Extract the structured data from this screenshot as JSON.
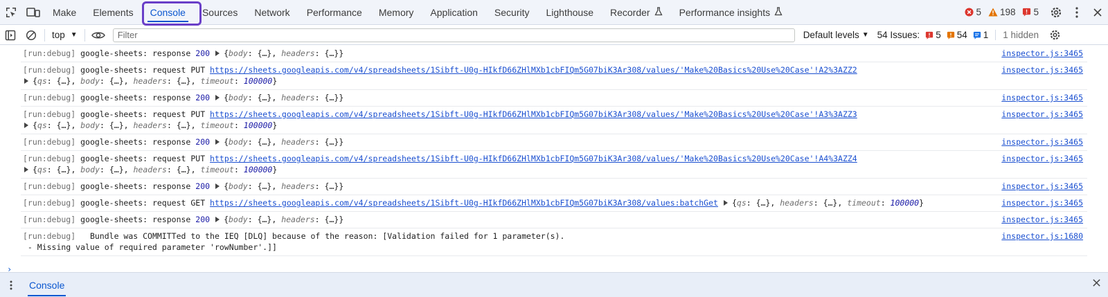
{
  "tabs": [
    {
      "label": "Make",
      "active": false,
      "flask": false
    },
    {
      "label": "Elements",
      "active": false,
      "flask": false
    },
    {
      "label": "Console",
      "active": true,
      "flask": false
    },
    {
      "label": "Sources",
      "active": false,
      "flask": false
    },
    {
      "label": "Network",
      "active": false,
      "flask": false
    },
    {
      "label": "Performance",
      "active": false,
      "flask": false
    },
    {
      "label": "Memory",
      "active": false,
      "flask": false
    },
    {
      "label": "Application",
      "active": false,
      "flask": false
    },
    {
      "label": "Security",
      "active": false,
      "flask": false
    },
    {
      "label": "Lighthouse",
      "active": false,
      "flask": false
    },
    {
      "label": "Recorder",
      "active": false,
      "flask": true
    },
    {
      "label": "Performance insights",
      "active": false,
      "flask": true
    }
  ],
  "counts": {
    "errors": "5",
    "warnings": "198",
    "issues": "5"
  },
  "toolbar": {
    "context": "top",
    "filter_placeholder": "Filter",
    "levels": "Default levels",
    "issues_label": "54 Issues:",
    "issues_errors": "5",
    "issues_warnings": "54",
    "issues_info": "1",
    "hidden": "1 hidden"
  },
  "messages": [
    {
      "prefix": "[run:debug]",
      "text": "google-sheets: response ",
      "num": "200",
      "obj": "response",
      "source": "inspector.js:3465"
    },
    {
      "prefix": "[run:debug]",
      "text": "google-sheets: request PUT ",
      "url": "https://sheets.googleapis.com/v4/spreadsheets/1Sibft-U0g-HIkfD66ZHlMXb1cbFIQm5G07biK3Ar308/values/'Make%20Basics%20Use%20Case'!A2%3AZZ2",
      "obj": "request",
      "source": "inspector.js:3465"
    },
    {
      "prefix": "[run:debug]",
      "text": "google-sheets: response ",
      "num": "200",
      "obj": "response",
      "source": "inspector.js:3465"
    },
    {
      "prefix": "[run:debug]",
      "text": "google-sheets: request PUT ",
      "url": "https://sheets.googleapis.com/v4/spreadsheets/1Sibft-U0g-HIkfD66ZHlMXb1cbFIQm5G07biK3Ar308/values/'Make%20Basics%20Use%20Case'!A3%3AZZ3",
      "obj": "request",
      "source": "inspector.js:3465"
    },
    {
      "prefix": "[run:debug]",
      "text": "google-sheets: response ",
      "num": "200",
      "obj": "response",
      "source": "inspector.js:3465"
    },
    {
      "prefix": "[run:debug]",
      "text": "google-sheets: request PUT ",
      "url": "https://sheets.googleapis.com/v4/spreadsheets/1Sibft-U0g-HIkfD66ZHlMXb1cbFIQm5G07biK3Ar308/values/'Make%20Basics%20Use%20Case'!A4%3AZZ4",
      "obj": "request",
      "source": "inspector.js:3465"
    },
    {
      "prefix": "[run:debug]",
      "text": "google-sheets: response ",
      "num": "200",
      "obj": "response",
      "source": "inspector.js:3465"
    },
    {
      "prefix": "[run:debug]",
      "text": "google-sheets: request GET ",
      "url": "https://sheets.googleapis.com/v4/spreadsheets/1Sibft-U0g-HIkfD66ZHlMXb1cbFIQm5G07biK3Ar308/values:batchGet",
      "obj": "get",
      "source": "inspector.js:3465"
    },
    {
      "prefix": "[run:debug]",
      "text": "google-sheets: response ",
      "num": "200",
      "obj": "response",
      "source": "inspector.js:3465"
    },
    {
      "prefix": "[run:debug]",
      "text": "  Bundle was COMMITTed to the IEQ [DLQ] because of the reason: [Validation failed for 1 parameter(s).",
      "text2": " - Missing value of required parameter 'rowNumber'.]]",
      "source": "inspector.js:1680"
    }
  ],
  "objects": {
    "response": {
      "k1": "body",
      "k2": "headers",
      "v": "{…}"
    },
    "request": {
      "k1": "qs",
      "k2": "body",
      "k3": "headers",
      "k4": "timeout",
      "v": "{…}",
      "timeout": "100000"
    },
    "get": {
      "k1": "qs",
      "k2": "headers",
      "k3": "timeout",
      "v": "{…}",
      "timeout": "100000"
    }
  },
  "prompt": "›",
  "drawer": {
    "tab": "Console"
  },
  "colors": {
    "accent": "#0b57d0",
    "highlight": "#6a3fc8",
    "error": "#dc362e",
    "warning": "#e37400",
    "info": "#1a73e8"
  }
}
